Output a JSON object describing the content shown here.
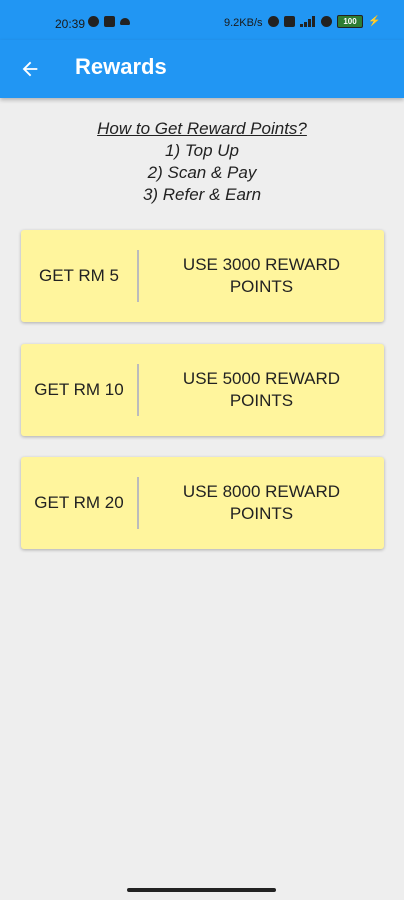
{
  "status_bar": {
    "time": "20:39",
    "net_speed": "9.2KB/s",
    "battery": "100"
  },
  "app_bar": {
    "title": "Rewards",
    "back_icon": "arrow-left-icon"
  },
  "howto": {
    "title": "How to Get Reward Points?",
    "steps": [
      "1) Top Up",
      "2) Scan & Pay",
      "3) Refer & Earn"
    ]
  },
  "rewards": [
    {
      "get_label": "GET RM 5",
      "use_label": "USE 3000 REWARD POINTS"
    },
    {
      "get_label": "GET RM 10",
      "use_label": "USE 5000 REWARD POINTS"
    },
    {
      "get_label": "GET RM 20",
      "use_label": "USE 8000 REWARD POINTS"
    }
  ],
  "colors": {
    "primary": "#2196f3",
    "card": "#fff59d",
    "background": "#eeeeee"
  }
}
